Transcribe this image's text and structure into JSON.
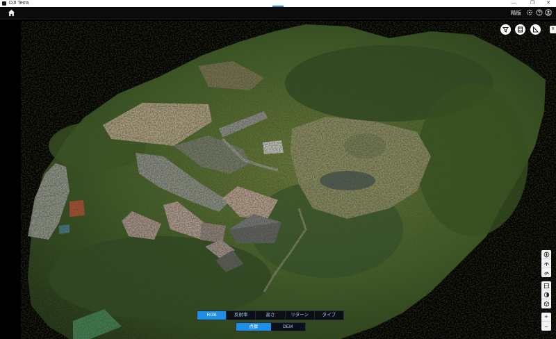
{
  "window": {
    "title": "DJI Terra",
    "minimize_glyph": "—",
    "restore_glyph": "❐",
    "close_glyph": "✕"
  },
  "header": {
    "home_icon": "home-icon",
    "edit_label": "精版",
    "icons": [
      "settings-icon",
      "help-icon",
      "user-icon"
    ]
  },
  "view_tools": {
    "top": [
      "filter-icon",
      "layers-icon",
      "measure-icon"
    ],
    "edge_tab": "R"
  },
  "side_tools": {
    "group1": [
      "compass-icon",
      "view-top-icon",
      "view-angle-icon"
    ],
    "group2": [
      "grid-icon",
      "half-sphere-icon",
      "cube-icon"
    ],
    "zoom_in": "+",
    "zoom_out": "−"
  },
  "mode_bar": {
    "tabs": [
      "RGB",
      "反射率",
      "高さ",
      "リターン",
      "タイプ"
    ],
    "active_index": 0
  },
  "view_bar": {
    "tabs": [
      "点群",
      "DEM"
    ],
    "active_index": 0
  }
}
